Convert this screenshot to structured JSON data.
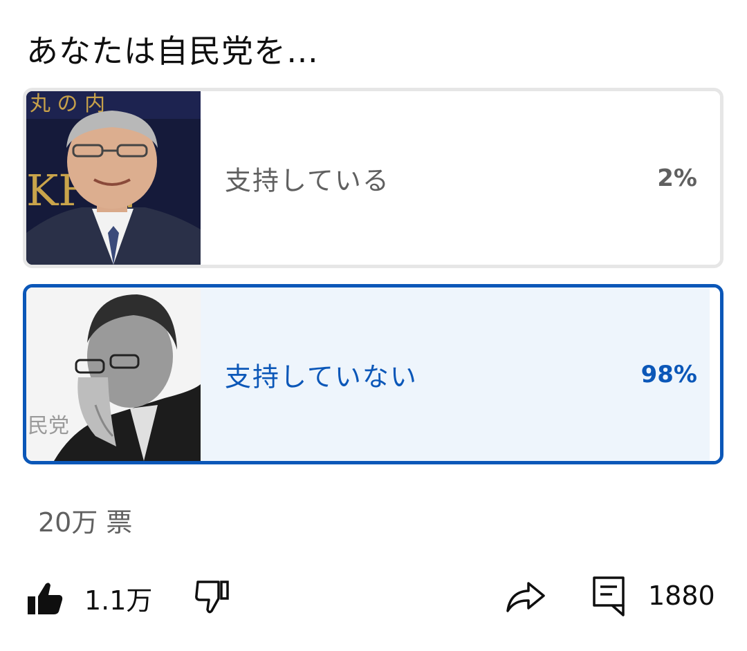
{
  "poll": {
    "title": "あなたは自民党を…",
    "options": [
      {
        "label": "支持している",
        "percent_text": "2%",
        "percent": 2,
        "selected": false,
        "image": "photo-smiling-man"
      },
      {
        "label": "支持していない",
        "percent_text": "98%",
        "percent": 98,
        "selected": true,
        "image": "photo-tired-man-bw"
      }
    ],
    "votes": "20万 票"
  },
  "actions": {
    "like_count": "1.1万",
    "comment_count": "1880",
    "icons": [
      "thumbs-up-icon",
      "thumbs-down-icon",
      "share-icon",
      "comment-icon"
    ]
  },
  "colors": {
    "accent": "#0b57b8",
    "selected_fill": "#eef5fc",
    "neutral_border": "#e6e6e6",
    "muted_text": "#606060"
  }
}
